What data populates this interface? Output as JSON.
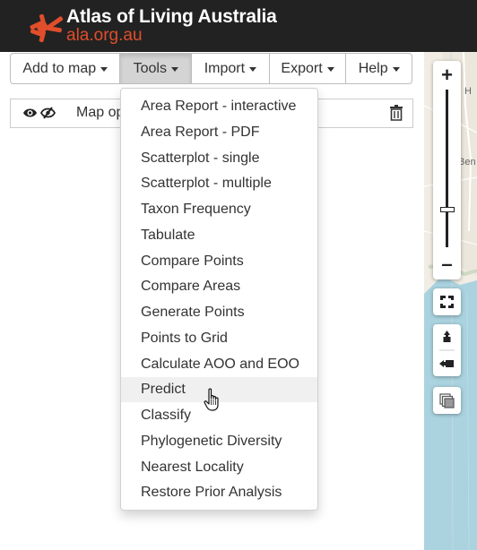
{
  "header": {
    "title": "Atlas of Living Australia",
    "subtitle": "ala.org.au",
    "brand_color": "#e04e2b"
  },
  "toolbar": {
    "buttons": [
      {
        "label": "Add to map",
        "has_caret": true
      },
      {
        "label": "Tools",
        "has_caret": true,
        "active": true
      },
      {
        "label": "Import",
        "has_caret": true
      },
      {
        "label": "Export",
        "has_caret": true
      },
      {
        "label": "Help",
        "has_caret": true
      }
    ]
  },
  "layer_row": {
    "label": "Map op"
  },
  "tools_menu": {
    "items": [
      "Area Report - interactive",
      "Area Report - PDF",
      "Scatterplot - single",
      "Scatterplot - multiple",
      "Taxon Frequency",
      "Tabulate",
      "Compare Points",
      "Compare Areas",
      "Generate Points",
      "Points to Grid",
      "Calculate AOO and EOO",
      "Predict",
      "Classify",
      "Phylogenetic Diversity",
      "Nearest Locality",
      "Restore Prior Analysis"
    ],
    "hovered_item": "Predict"
  },
  "map": {
    "labels": [
      "H",
      "Ben"
    ],
    "zoom_in_label": "+",
    "zoom_out_label": "–",
    "water_color": "#aad3df",
    "land_color": "#f1ede4"
  }
}
